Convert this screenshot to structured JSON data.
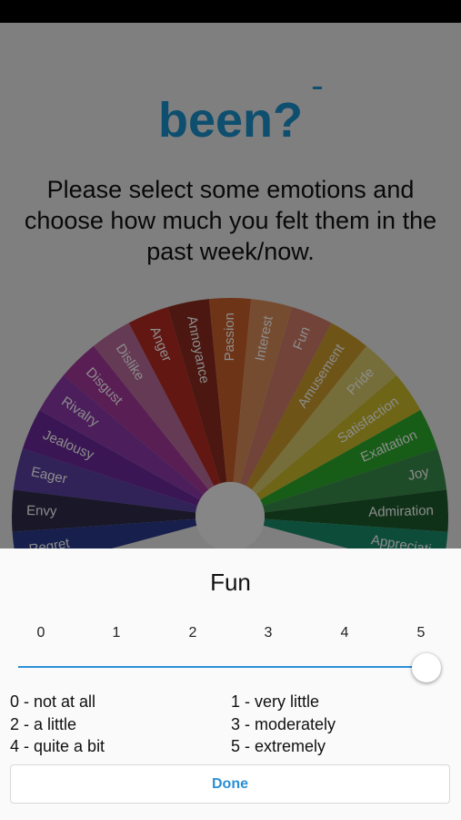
{
  "header": {
    "title": "been?",
    "instructions": "Please select some emotions and choose how much you felt them in the past week/now."
  },
  "wheel": {
    "segments": [
      {
        "label": "Envy",
        "color": "#2e2a4a"
      },
      {
        "label": "Eager",
        "color": "#5a3fa0"
      },
      {
        "label": "Jealousy",
        "color": "#6a2a9a"
      },
      {
        "label": "Rivalry",
        "color": "#8a3aa8"
      },
      {
        "label": "Disgust",
        "color": "#a2389a"
      },
      {
        "label": "Dislike",
        "color": "#b86a9a"
      },
      {
        "label": "Anger",
        "color": "#b22a22"
      },
      {
        "label": "Annoyance",
        "color": "#8a2a1e"
      },
      {
        "label": "Passion",
        "color": "#c8602a"
      },
      {
        "label": "Interest",
        "color": "#d88a5a"
      },
      {
        "label": "Fun",
        "color": "#d07a66"
      },
      {
        "label": "Amusement",
        "color": "#c89a2a"
      },
      {
        "label": "Pride",
        "color": "#d8c86a"
      },
      {
        "label": "Satisfaction",
        "color": "#c8b82a"
      },
      {
        "label": "Exaltation",
        "color": "#2aa82a"
      },
      {
        "label": "Joy",
        "color": "#3a8a4a"
      },
      {
        "label": "Admiration",
        "color": "#1a5a2a"
      }
    ],
    "partial_labels": {
      "left": "Regret",
      "right": "Appreciati"
    }
  },
  "sheet": {
    "title": "Fun",
    "ticks": [
      "0",
      "1",
      "2",
      "3",
      "4",
      "5"
    ],
    "slider_value": 5,
    "slider_max": 5,
    "legend": [
      "0 - not at all",
      "1 - very little",
      "2 - a little",
      "3 - moderately",
      "4 - quite a bit",
      "5 - extremely"
    ],
    "done_label": "Done"
  },
  "colors": {
    "accent": "#1b8fc9",
    "slider": "#2b8fd6"
  }
}
